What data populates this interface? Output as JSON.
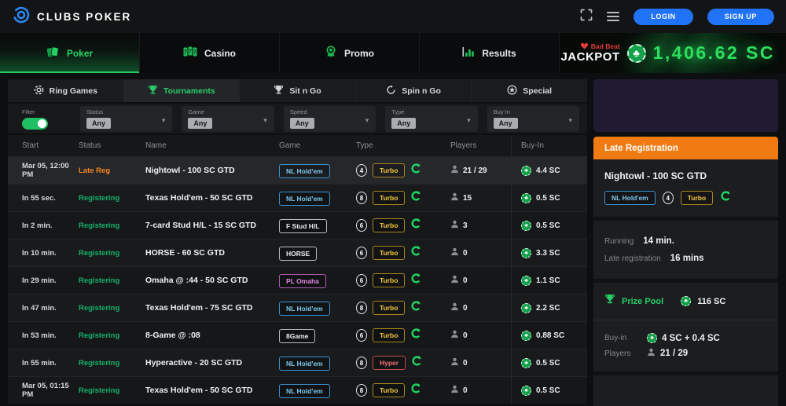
{
  "header": {
    "brand": "CLUBS POKER",
    "login_label": "LOGIN",
    "signup_label": "SIGN UP"
  },
  "nav": {
    "tabs": [
      {
        "label": "Poker"
      },
      {
        "label": "Casino"
      },
      {
        "label": "Promo"
      },
      {
        "label": "Results"
      }
    ],
    "jackpot": {
      "badge": "Bad Beat",
      "label": "JACKPOT",
      "amount": "1,406.62 SC"
    }
  },
  "subtabs": [
    {
      "label": "Ring Games"
    },
    {
      "label": "Tournaments"
    },
    {
      "label": "Sit n Go"
    },
    {
      "label": "Spin n Go"
    },
    {
      "label": "Special"
    }
  ],
  "filters": {
    "filter_label": "Filter",
    "dropdowns": [
      {
        "label": "Status",
        "value": "Any"
      },
      {
        "label": "Game",
        "value": "Any"
      },
      {
        "label": "Speed",
        "value": "Any"
      },
      {
        "label": "Type",
        "value": "Any"
      },
      {
        "label": "Buy In",
        "value": "Any"
      }
    ]
  },
  "table": {
    "columns": [
      "Start",
      "Status",
      "Name",
      "Game",
      "Type",
      "Players",
      "Buy-In"
    ],
    "rows": [
      {
        "start": "Mar 05, 12:00 PM",
        "status": "Late Reg",
        "status_type": "late",
        "name": "Nightowl - 100 SC GTD",
        "game": "NL Hold'em",
        "game_color": "blue",
        "seats": "4",
        "speed": "Turbo",
        "speed_color": "gold",
        "players": "21 / 29",
        "buyin": "4.4 SC",
        "selected": true
      },
      {
        "start": "In 55 sec.",
        "status": "Registering",
        "status_type": "reg",
        "name": "Texas Hold'em - 50 SC GTD",
        "game": "NL Hold'em",
        "game_color": "blue",
        "seats": "8",
        "speed": "Turbo",
        "speed_color": "gold",
        "players": "15",
        "buyin": "0.5 SC",
        "selected": false
      },
      {
        "start": "In 2 min.",
        "status": "Registering",
        "status_type": "reg",
        "name": "7-card Stud H/L - 15 SC GTD",
        "game": "F Stud H/L",
        "game_color": "white",
        "seats": "6",
        "speed": "Turbo",
        "speed_color": "gold",
        "players": "3",
        "buyin": "0.5 SC",
        "selected": false
      },
      {
        "start": "In 10 min.",
        "status": "Registering",
        "status_type": "reg",
        "name": "HORSE - 60 SC GTD",
        "game": "HORSE",
        "game_color": "white",
        "seats": "6",
        "speed": "Turbo",
        "speed_color": "gold",
        "players": "0",
        "buyin": "3.3 SC",
        "selected": false
      },
      {
        "start": "In 29 min.",
        "status": "Registering",
        "status_type": "reg",
        "name": "Omaha @ :44 - 50 SC GTD",
        "game": "PL Omaha",
        "game_color": "pink",
        "seats": "6",
        "speed": "Turbo",
        "speed_color": "gold",
        "players": "0",
        "buyin": "1.1 SC",
        "selected": false
      },
      {
        "start": "In 47 min.",
        "status": "Registering",
        "status_type": "reg",
        "name": "Texas Hold'em - 75 SC GTD",
        "game": "NL Hold'em",
        "game_color": "blue",
        "seats": "8",
        "speed": "Turbo",
        "speed_color": "gold",
        "players": "0",
        "buyin": "2.2 SC",
        "selected": false
      },
      {
        "start": "In 53 min.",
        "status": "Registering",
        "status_type": "reg",
        "name": "8-Game @ :08",
        "game": "8Game",
        "game_color": "white",
        "seats": "6",
        "speed": "Turbo",
        "speed_color": "gold",
        "players": "0",
        "buyin": "0.88 SC",
        "selected": false
      },
      {
        "start": "In 55 min.",
        "status": "Registering",
        "status_type": "reg",
        "name": "Hyperactive - 20 SC GTD",
        "game": "NL Hold'em",
        "game_color": "blue",
        "seats": "8",
        "speed": "Hyper",
        "speed_color": "red",
        "players": "0",
        "buyin": "0.5 SC",
        "selected": false
      },
      {
        "start": "Mar 05, 01:15 PM",
        "status": "Registering",
        "status_type": "reg",
        "name": "Texas Hold'em - 50 SC GTD",
        "game": "NL Hold'em",
        "game_color": "blue",
        "seats": "8",
        "speed": "Turbo",
        "speed_color": "gold",
        "players": "0",
        "buyin": "0.5 SC",
        "selected": false
      }
    ]
  },
  "panel": {
    "header": "Late Registration",
    "title": "Nightowl - 100 SC GTD",
    "game_badge": "NL Hold'em",
    "seats": "4",
    "speed_badge": "Turbo",
    "running_label": "Running",
    "running_value": "14 min.",
    "latereg_label": "Late registration",
    "latereg_value": "16 mins",
    "prize_pool_label": "Prize Pool",
    "prize_pool_value": "116 SC",
    "buyin_label": "Buy-in",
    "buyin_value": "4 SC + 0.4 SC",
    "players_label": "Players",
    "players_value": "21 / 29"
  }
}
